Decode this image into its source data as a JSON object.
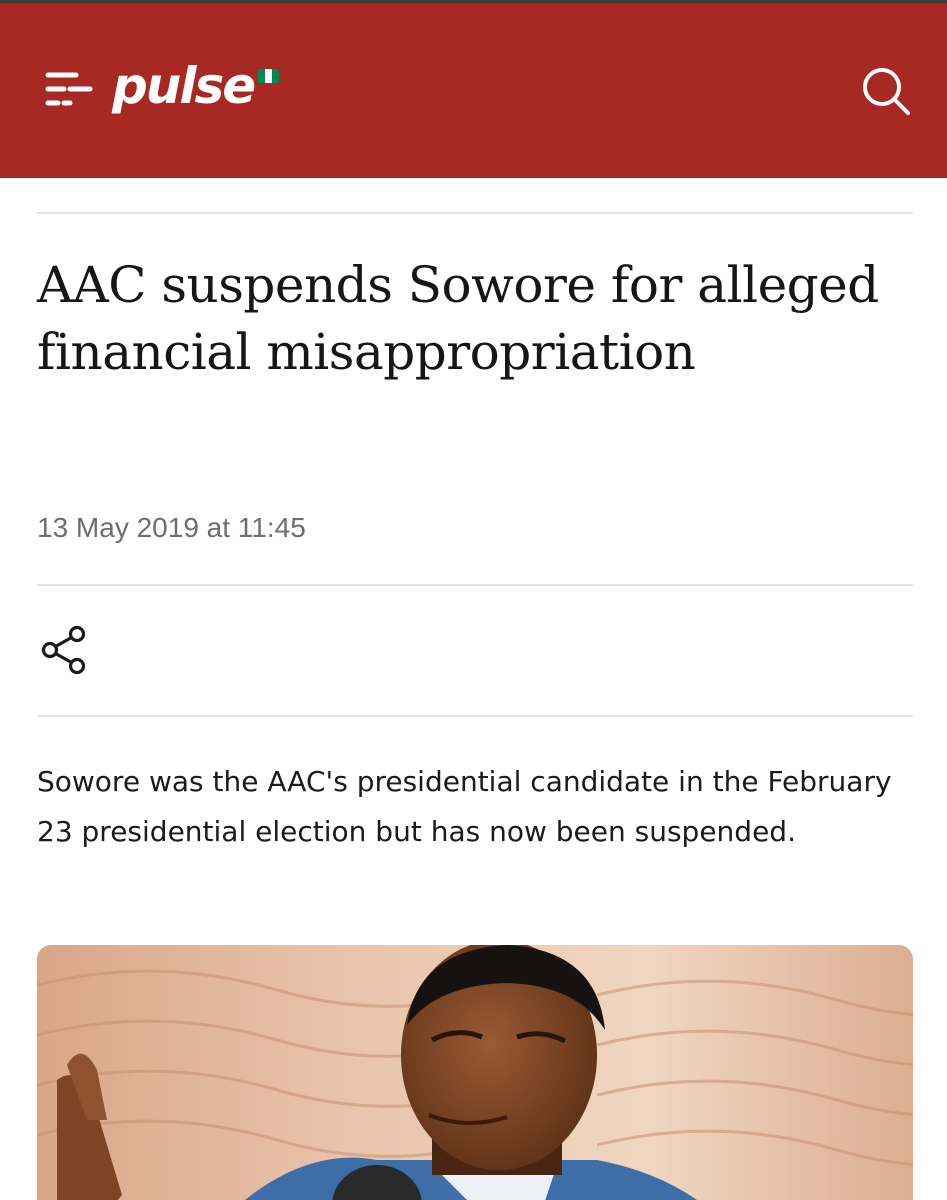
{
  "header": {
    "logo_text": "pulse",
    "menu_icon": "hamburger-menu-icon",
    "search_icon": "search-icon",
    "brand_color": "#a82824",
    "flag_colors": [
      "#008751",
      "#ffffff",
      "#008751"
    ]
  },
  "article": {
    "headline": "AAC suspends Sowore for alleged financial misappropriation",
    "timestamp": "13 May 2019 at 11:45",
    "share_icon": "share-icon",
    "summary": "Sowore was the AAC's presidential candidate in the February 23 presidential election but has now been suspended."
  }
}
